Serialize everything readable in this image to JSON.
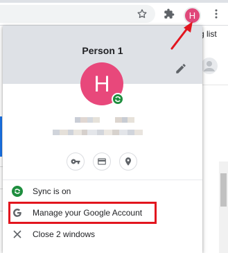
{
  "browser": {
    "toolbar_icons": [
      "star-icon",
      "puzzle-icon",
      "avatar",
      "kebab-menu-icon"
    ],
    "avatar_initial": "H",
    "background_page_text": "g list"
  },
  "profile_popup": {
    "name": "Person 1",
    "avatar_initial": "H",
    "avatar_color": "#e8487b",
    "header_color": "#dee1e6",
    "sync_badge_color": "#1e8e3e",
    "quick_actions": [
      {
        "name": "passwords",
        "icon": "key-icon"
      },
      {
        "name": "payment-methods",
        "icon": "credit-card-icon"
      },
      {
        "name": "addresses",
        "icon": "location-pin-icon"
      }
    ],
    "menu_items": [
      {
        "label": "Sync is on",
        "icon": "sync-icon"
      },
      {
        "label": "Manage your Google Account",
        "icon": "google-g-icon"
      },
      {
        "label": "Close 2 windows",
        "icon": "close-icon"
      }
    ]
  },
  "annotations": {
    "highlight_color": "#e2151e",
    "highlighted_item": "Manage your Google Account"
  }
}
